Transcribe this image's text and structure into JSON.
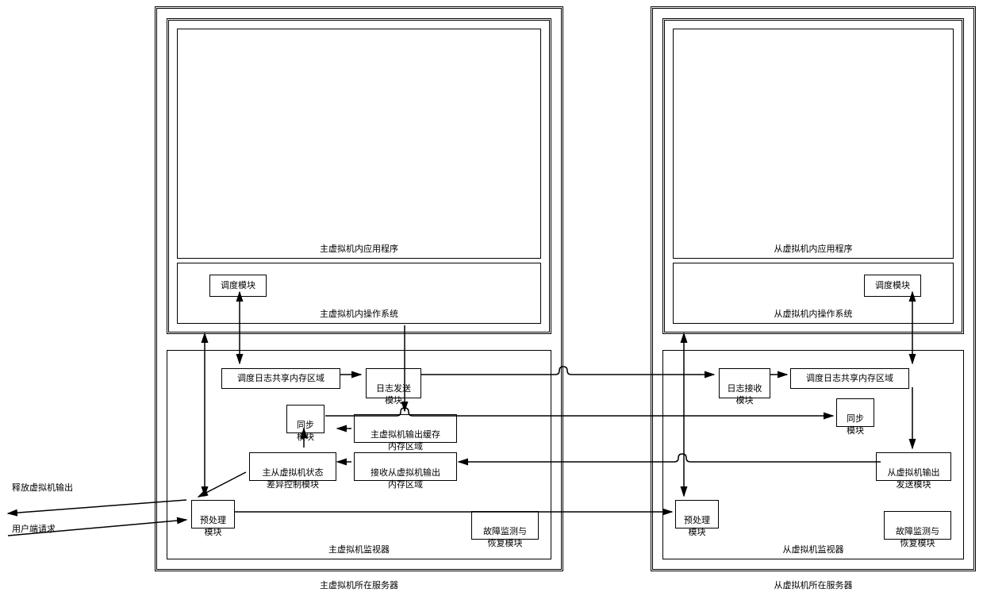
{
  "primary": {
    "serverLabel": "主虚拟机所在服务器",
    "inner": {
      "appLabel": "主虚拟机内应用程序",
      "osLabel": "主虚拟机内操作系统",
      "scheduleModule": "调度模块"
    },
    "monitor": {
      "label": "主虚拟机监视器",
      "scheduleLogMem": "调度日志共享内存区域",
      "logSendModule": "日志发送\n模块",
      "syncModule": "同步\n模块",
      "outputBufferMem": "主虚拟机输出缓存\n内存区域",
      "stateDiffModule": "主从虚拟机状态\n差异控制模块",
      "recvOutputMem": "接收从虚拟机输出\n内存区域",
      "preprocessModule": "预处理\n模块",
      "faultModule": "故障监测与\n恢复模块"
    }
  },
  "secondary": {
    "serverLabel": "从虚拟机所在服务器",
    "inner": {
      "appLabel": "从虚拟机内应用程序",
      "osLabel": "从虚拟机内操作系统",
      "scheduleModule": "调度模块"
    },
    "monitor": {
      "label": "从虚拟机监视器",
      "logRecvModule": "日志接收\n模块",
      "scheduleLogMem": "调度日志共享内存区域",
      "syncModule": "同步\n模块",
      "outputSendModule": "从虚拟机输出\n发送模块",
      "preprocessModule": "预处理\n模块",
      "faultModule": "故障监测与\n恢复模块"
    }
  },
  "external": {
    "releaseOutput": "释放虚拟机输出",
    "clientRequest": "用户端请求"
  }
}
